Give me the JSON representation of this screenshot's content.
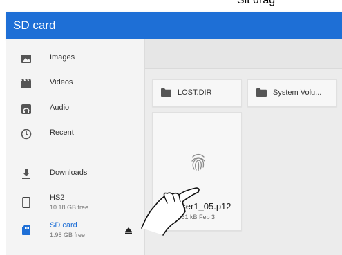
{
  "header": {
    "title": "SD card"
  },
  "partial_text": "Sit drag",
  "sidebar": {
    "items": [
      {
        "label": "Images",
        "icon": "image-icon"
      },
      {
        "label": "Videos",
        "icon": "video-icon"
      },
      {
        "label": "Audio",
        "icon": "audio-icon"
      },
      {
        "label": "Recent",
        "icon": "clock-icon"
      }
    ],
    "roots": [
      {
        "label": "Downloads",
        "icon": "download-icon"
      },
      {
        "label": "HS2",
        "sub": "10.18 GB free",
        "icon": "phone-icon"
      },
      {
        "label": "SD card",
        "sub": "1.98 GB free",
        "icon": "sdcard-icon",
        "active": true
      }
    ],
    "eject_icon": "eject-icon"
  },
  "main": {
    "folders": [
      {
        "label": "LOST.DIR",
        "icon": "folder-icon"
      },
      {
        "label": "System Volu...",
        "icon": "folder-icon"
      }
    ],
    "files": [
      {
        "name": "user1_05.p12",
        "meta": "3.61 kB Feb 3",
        "icon": "fingerprint-icon"
      }
    ]
  },
  "colors": {
    "accent": "#1e6fd6",
    "sidebar_bg": "#f4f4f4",
    "main_bg": "#ececec"
  }
}
